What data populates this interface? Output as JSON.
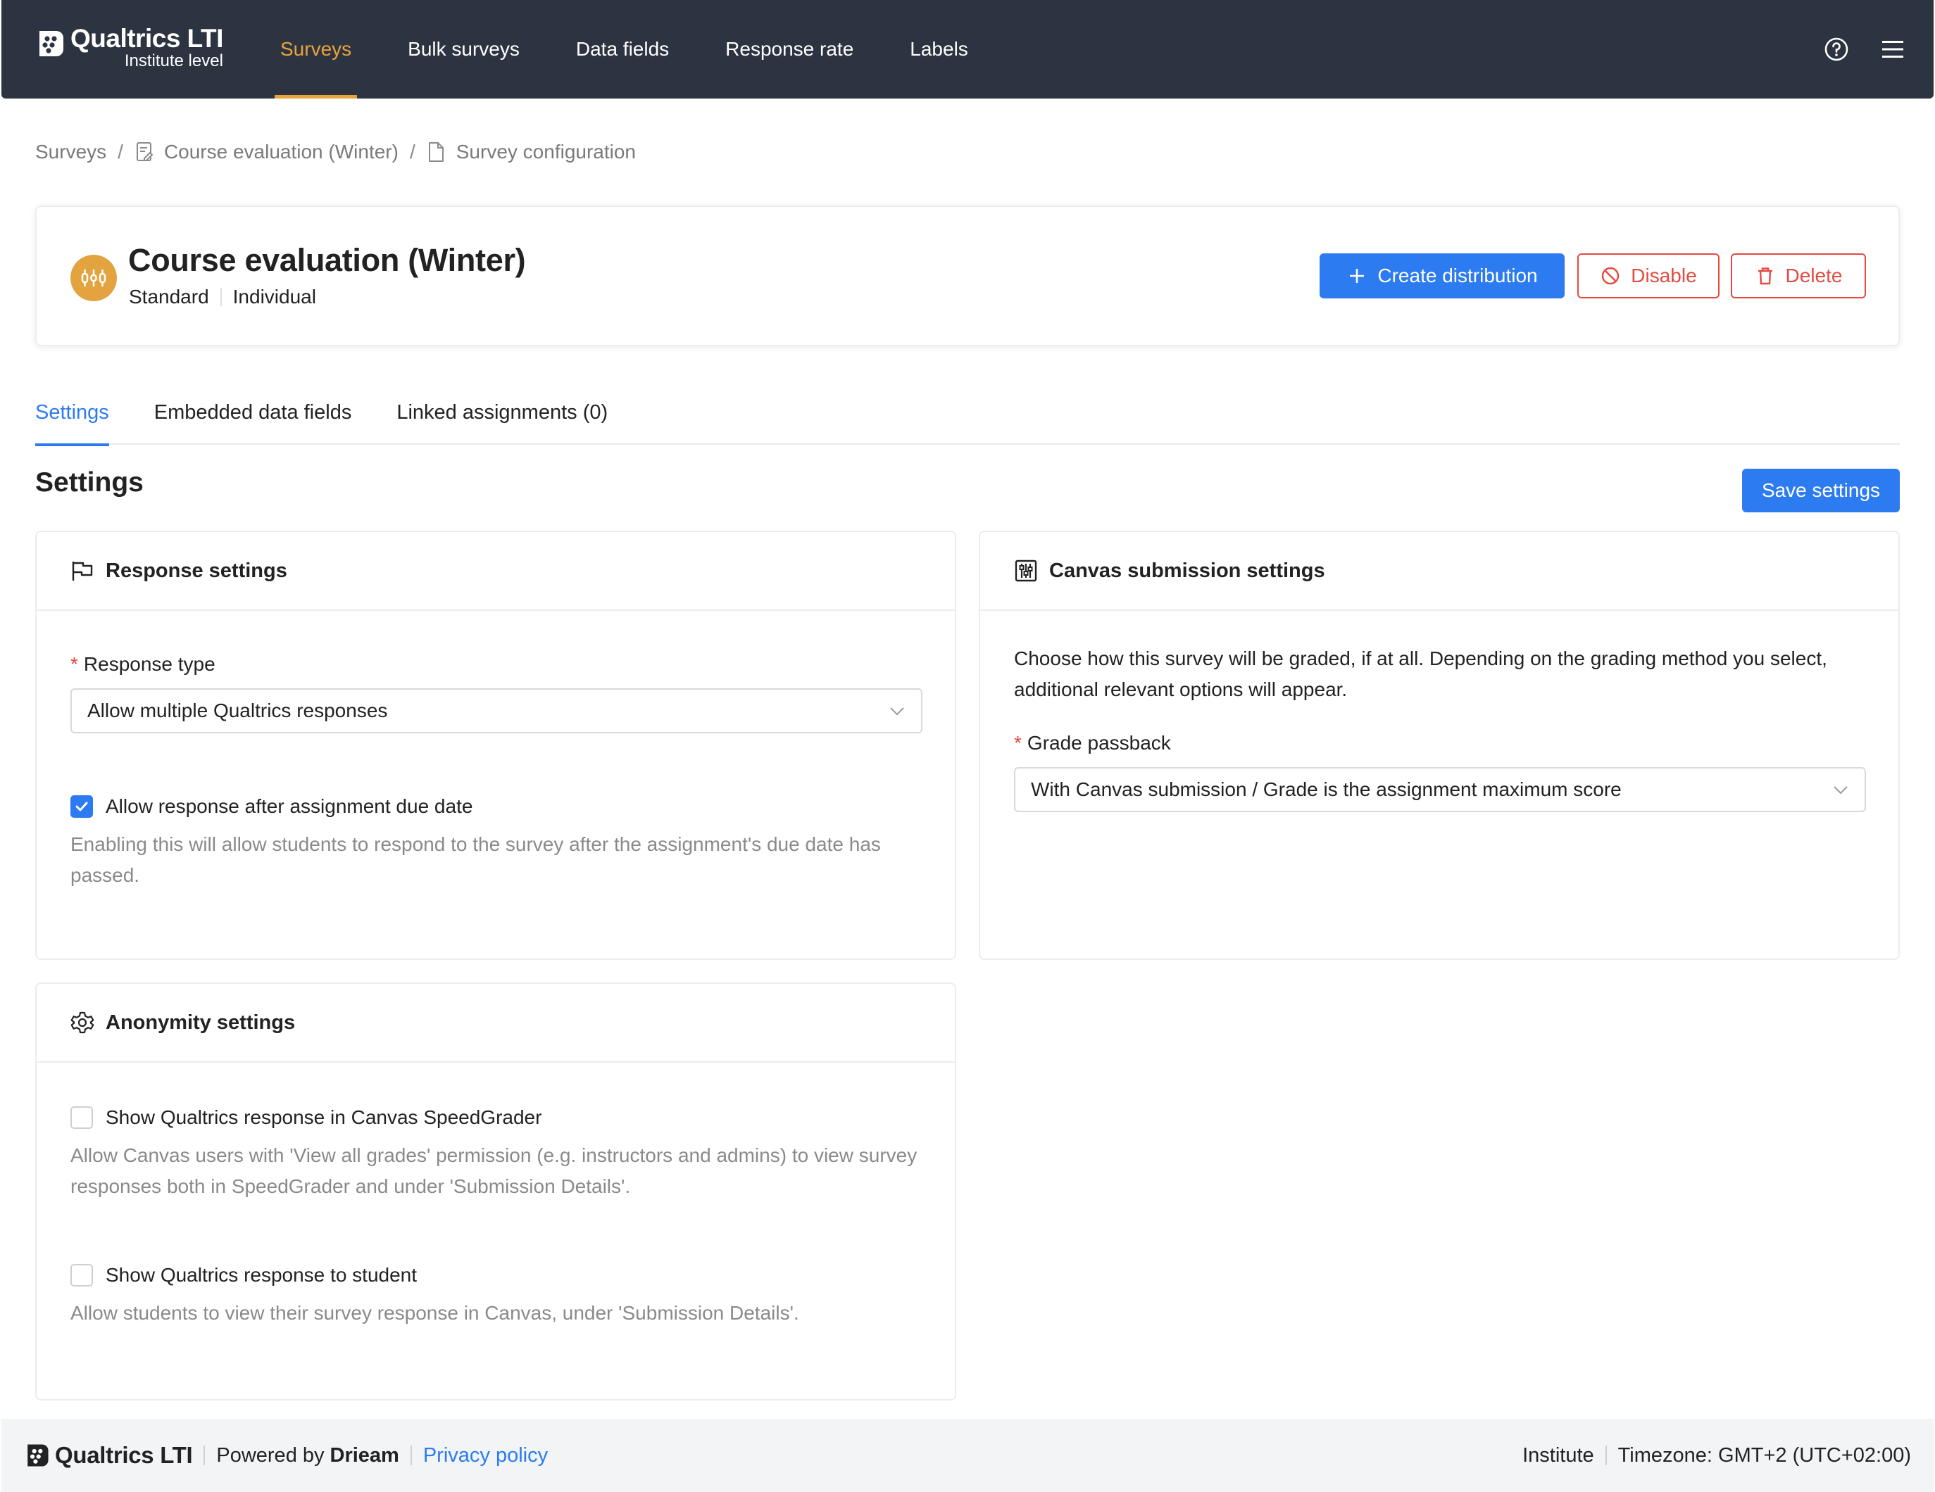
{
  "navbar": {
    "brand_name": "Qualtrics LTI",
    "brand_sub": "Institute level",
    "items": [
      {
        "label": "Surveys",
        "active": true
      },
      {
        "label": "Bulk surveys"
      },
      {
        "label": "Data fields"
      },
      {
        "label": "Response rate"
      },
      {
        "label": "Labels"
      }
    ],
    "icons": [
      "help-circle-icon",
      "menu-icon"
    ]
  },
  "breadcrumb": [
    "Surveys",
    "Course evaluation (Winter)",
    "Survey configuration"
  ],
  "survey": {
    "title": "Course evaluation (Winter)",
    "meta": [
      "Standard",
      "Individual"
    ],
    "actions": {
      "create": "Create distribution",
      "disable": "Disable",
      "delete": "Delete"
    }
  },
  "tabs": [
    "Settings",
    "Embedded data fields",
    "Linked assignments (0)"
  ],
  "section": {
    "title": "Settings",
    "save_label": "Save settings"
  },
  "response_settings": {
    "title": "Response settings",
    "response_type_label": "Response type",
    "response_type_value": "Allow multiple Qualtrics responses",
    "allow_late_label": "Allow response after assignment due date",
    "allow_late_checked": true,
    "allow_late_help": "Enabling this will allow students to respond to the survey after the assignment's due date has passed."
  },
  "canvas_settings": {
    "title": "Canvas submission settings",
    "description": "Choose how this survey will be graded, if at all. Depending on the grading method you select, additional relevant options will appear.",
    "grade_label": "Grade passback",
    "grade_value": "With Canvas submission / Grade is the assignment maximum score"
  },
  "anonymity_settings": {
    "title": "Anonymity settings",
    "speedgrader_label": "Show Qualtrics response in Canvas SpeedGrader",
    "speedgrader_checked": false,
    "speedgrader_help": "Allow Canvas users with 'View all grades' permission (e.g. instructors and admins) to view survey responses both in SpeedGrader and under 'Submission Details'.",
    "student_label": "Show Qualtrics response to student",
    "student_checked": false,
    "student_help": "Allow students to view their survey response in Canvas, under 'Submission Details'."
  },
  "footer": {
    "brand": "Qualtrics LTI",
    "powered_prefix": "Powered by",
    "powered_by": "Drieam",
    "privacy": "Privacy policy",
    "institute": "Institute",
    "timezone": "Timezone: GMT+2 (UTC+02:00)"
  },
  "colors": {
    "navbar_bg": "#2d3441",
    "accent_orange": "#e8a33b",
    "primary_blue": "#2d7bf0",
    "danger_red": "#e44a40"
  }
}
